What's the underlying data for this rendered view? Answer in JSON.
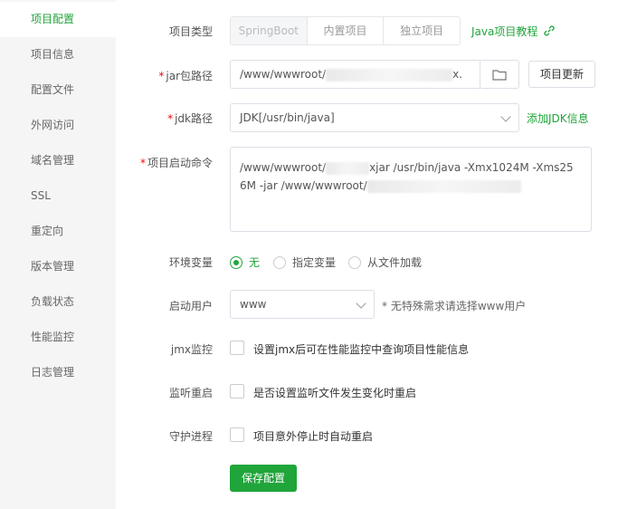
{
  "sidebar": {
    "items": [
      {
        "label": "项目配置",
        "active": true
      },
      {
        "label": "项目信息"
      },
      {
        "label": "配置文件"
      },
      {
        "label": "外网访问"
      },
      {
        "label": "域名管理"
      },
      {
        "label": "SSL"
      },
      {
        "label": "重定向"
      },
      {
        "label": "版本管理"
      },
      {
        "label": "负载状态"
      },
      {
        "label": "性能监控"
      },
      {
        "label": "日志管理"
      }
    ]
  },
  "form": {
    "project_type": {
      "label": "项目类型",
      "options": [
        "SpringBoot",
        "内置项目",
        "独立项目"
      ],
      "selected": "SpringBoot",
      "tutorial_link": "Java项目教程"
    },
    "jar_path": {
      "required": "*",
      "label": "jar包路径",
      "value_prefix": "/www/wwwroot/",
      "value_suffix": "x.",
      "update_button": "项目更新"
    },
    "jdk_path": {
      "required": "*",
      "label": "jdk路径",
      "value": "JDK[/usr/bin/java]",
      "add_link": "添加JDK信息"
    },
    "start_command": {
      "required": "*",
      "label": "项目启动命令",
      "line1_prefix": "/www/wwwroot/",
      "line1_suffix": "xjar  /usr/bin/java  -Xmx1024M -Xms25",
      "line2_prefix": "6M  -jar  /www/wwwroot/"
    },
    "env_vars": {
      "label": "环境变量",
      "options": [
        "无",
        "指定变量",
        "从文件加载"
      ],
      "selected": "无"
    },
    "start_user": {
      "label": "启动用户",
      "value": "www",
      "hint": "* 无特殊需求请选择www用户"
    },
    "jmx": {
      "label": "jmx监控",
      "text": "设置jmx后可在性能监控中查询项目性能信息"
    },
    "watch_restart": {
      "label": "监听重启",
      "text": "是否设置监听文件发生变化时重启"
    },
    "daemon": {
      "label": "守护进程",
      "text": "项目意外停止时自动重启"
    },
    "save_button": "保存配置"
  },
  "colors": {
    "accent": "#20a53a",
    "required": "#ef0808",
    "sidebar_bg": "#f5f5f5"
  }
}
